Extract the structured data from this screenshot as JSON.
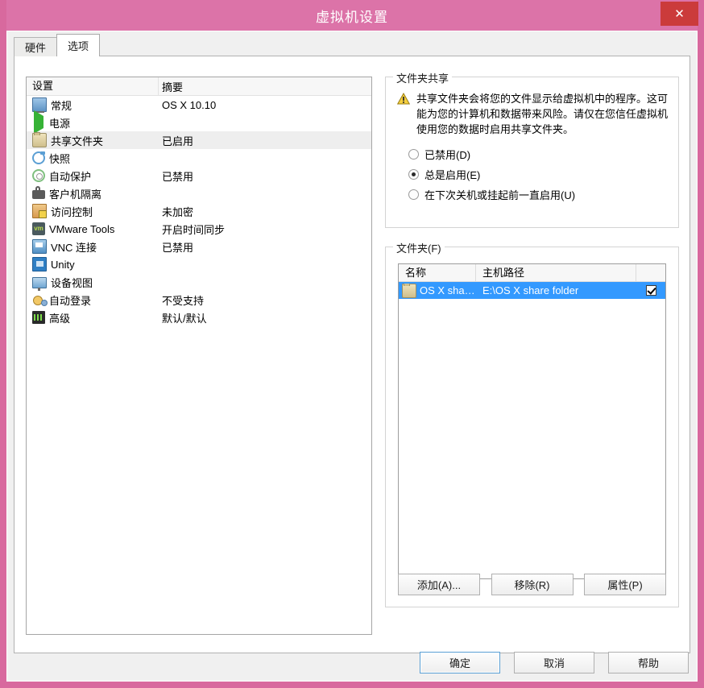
{
  "window": {
    "title": "虚拟机设置",
    "close_label": "✕",
    "accent_pink": "#dc73a8",
    "close_red": "#cb3b3b",
    "selection_blue": "#3399ff"
  },
  "tabs": [
    {
      "label": "硬件",
      "active": false
    },
    {
      "label": "选项",
      "active": true
    }
  ],
  "settings_list": {
    "headers": {
      "setting": "设置",
      "summary": "摘要"
    },
    "rows": [
      {
        "icon": "monitor-icon",
        "label": "常规",
        "summary": "OS X 10.10",
        "selected": false
      },
      {
        "icon": "power-play-icon",
        "label": "电源",
        "summary": "",
        "selected": false
      },
      {
        "icon": "folder-icon",
        "label": "共享文件夹",
        "summary": "已启用",
        "selected": true
      },
      {
        "icon": "snapshot-icon",
        "label": "快照",
        "summary": "",
        "selected": false
      },
      {
        "icon": "autoprotect-icon",
        "label": "自动保护",
        "summary": "已禁用",
        "selected": false
      },
      {
        "icon": "lock-icon",
        "label": "客户机隔离",
        "summary": "",
        "selected": false
      },
      {
        "icon": "access-control-icon",
        "label": "访问控制",
        "summary": "未加密",
        "selected": false
      },
      {
        "icon": "vmware-tools-icon",
        "label": "VMware Tools",
        "summary": "开启时间同步",
        "selected": false
      },
      {
        "icon": "vnc-icon",
        "label": "VNC 连接",
        "summary": "已禁用",
        "selected": false
      },
      {
        "icon": "unity-icon",
        "label": "Unity",
        "summary": "",
        "selected": false
      },
      {
        "icon": "device-view-icon",
        "label": "设备视图",
        "summary": "",
        "selected": false
      },
      {
        "icon": "auto-login-icon",
        "label": "自动登录",
        "summary": "不受支持",
        "selected": false
      },
      {
        "icon": "advanced-icon",
        "label": "高级",
        "summary": "默认/默认",
        "selected": false
      }
    ]
  },
  "folder_sharing": {
    "group_title": "文件夹共享",
    "warning_icon": "warning-triangle-icon",
    "warning_text": "共享文件夹会将您的文件显示给虚拟机中的程序。这可能为您的计算机和数据带来风险。请仅在您信任虚拟机使用您的数据时启用共享文件夹。",
    "options": [
      {
        "label": "已禁用(D)",
        "checked": false
      },
      {
        "label": "总是启用(E)",
        "checked": true
      },
      {
        "label": "在下次关机或挂起前一直启用(U)",
        "checked": false
      }
    ]
  },
  "folders": {
    "group_title": "文件夹(F)",
    "headers": {
      "name": "名称",
      "path": "主机路径",
      "enabled": ""
    },
    "rows": [
      {
        "icon": "folder-icon",
        "name": "OS X sha…",
        "path": "E:\\OS X share folder",
        "enabled": true,
        "selected": true
      }
    ],
    "buttons": [
      {
        "label": "添加(A)..."
      },
      {
        "label": "移除(R)"
      },
      {
        "label": "属性(P)"
      }
    ]
  },
  "footer": {
    "ok": "确定",
    "cancel": "取消",
    "help": "帮助"
  }
}
